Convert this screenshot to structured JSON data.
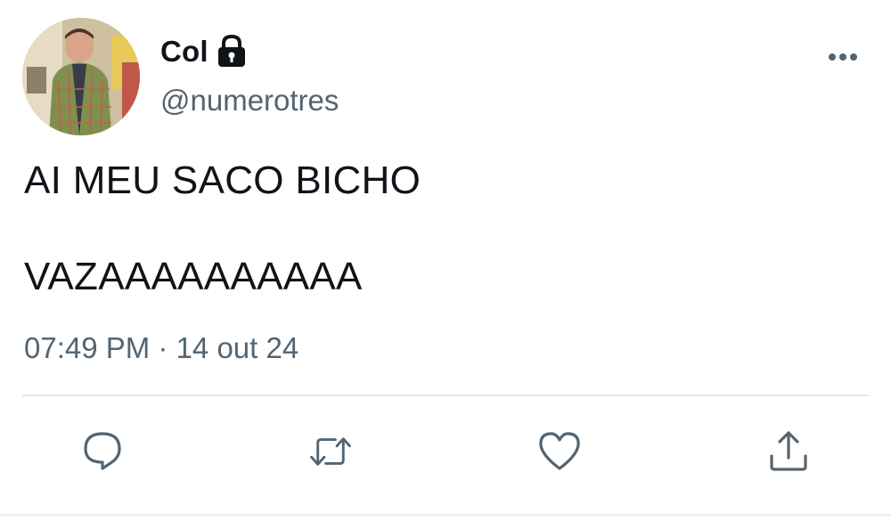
{
  "tweet": {
    "display_name": "Col",
    "handle": "@numerotres",
    "text_lines": [
      "AI MEU SACO BICHO",
      "VAZAAAAAAAAAA"
    ],
    "timestamp": "07:49 PM · 14 out 24"
  },
  "icons": {
    "lock": "lock-icon",
    "more": "more-horizontal-icon",
    "reply": "reply-icon",
    "retweet": "retweet-icon",
    "like": "heart-icon",
    "share": "share-icon"
  },
  "colors": {
    "text": "#0f1419",
    "secondary": "#536471",
    "divider": "#e6e9eb"
  }
}
